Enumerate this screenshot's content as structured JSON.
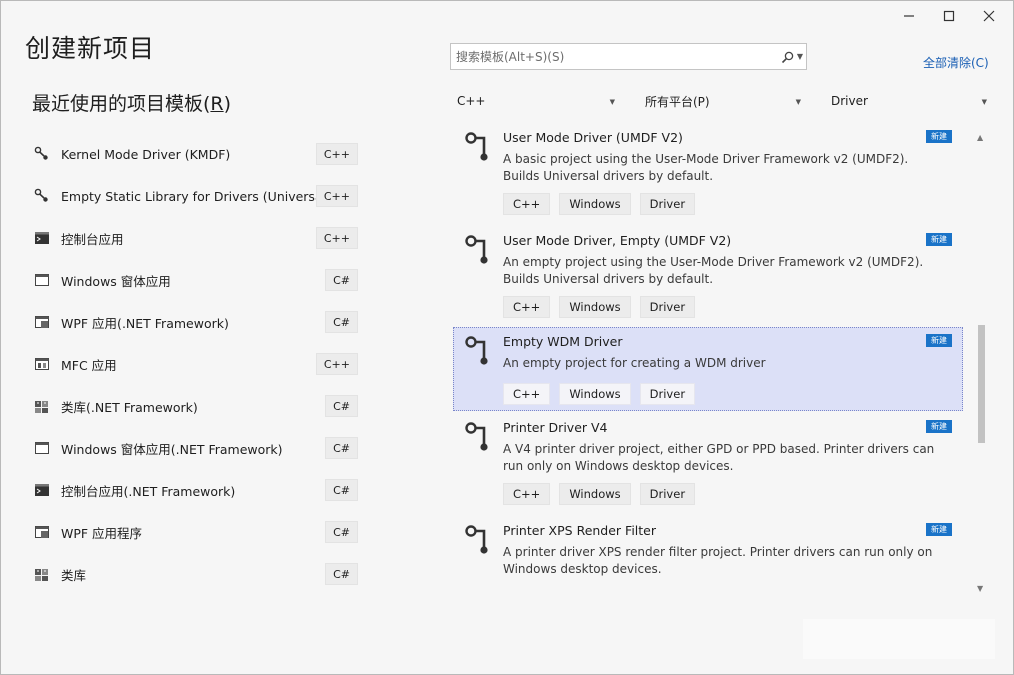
{
  "window": {
    "title": "创建新项目",
    "caption": {
      "minimize": "—",
      "maximize": "☐",
      "close": "✕"
    }
  },
  "recent": {
    "title_pre": "最近使用的项目模板(",
    "title_key": "R",
    "title_post": ")",
    "items": [
      {
        "name": "Kernel Mode Driver (KMDF)",
        "lang": "C++",
        "icon": "driver-icon"
      },
      {
        "name": "Empty Static Library for Drivers (Universal)",
        "lang": "C++",
        "icon": "driver-icon"
      },
      {
        "name": "控制台应用",
        "lang": "C++",
        "icon": "console-icon"
      },
      {
        "name": "Windows 窗体应用",
        "lang": "C#",
        "icon": "window-form-icon"
      },
      {
        "name": "WPF 应用(.NET Framework)",
        "lang": "C#",
        "icon": "wpf-icon"
      },
      {
        "name": "MFC 应用",
        "lang": "C++",
        "icon": "mfc-icon"
      },
      {
        "name": "类库(.NET Framework)",
        "lang": "C#",
        "icon": "class-library-icon"
      },
      {
        "name": "Windows 窗体应用(.NET Framework)",
        "lang": "C#",
        "icon": "window-form-icon"
      },
      {
        "name": "控制台应用(.NET Framework)",
        "lang": "C#",
        "icon": "console-icon"
      },
      {
        "name": "WPF 应用程序",
        "lang": "C#",
        "icon": "wpf-icon"
      },
      {
        "name": "类库",
        "lang": "C#",
        "icon": "class-library-icon"
      }
    ]
  },
  "search": {
    "placeholder": "搜索模板(Alt+S)(S)"
  },
  "clear_all": "全部清除(C)",
  "filters": {
    "language": "C++",
    "platform": "所有平台(P)",
    "project_type": "Driver"
  },
  "templates": [
    {
      "name": "User Mode Driver (UMDF V2)",
      "desc": "A basic project using the User-Mode Driver Framework v2 (UMDF2). Builds Universal drivers by default.",
      "tags": [
        "C++",
        "Windows",
        "Driver"
      ],
      "badge": "新建",
      "selected": false
    },
    {
      "name": "User Mode Driver, Empty (UMDF V2)",
      "desc": "An empty project using the User-Mode Driver Framework v2 (UMDF2). Builds Universal drivers by default.",
      "tags": [
        "C++",
        "Windows",
        "Driver"
      ],
      "badge": "新建",
      "selected": false
    },
    {
      "name": "Empty WDM Driver",
      "desc": "An empty project for creating a WDM driver",
      "tags": [
        "C++",
        "Windows",
        "Driver"
      ],
      "badge": "新建",
      "selected": true
    },
    {
      "name": "Printer Driver V4",
      "desc": "A V4 printer driver project, either GPD or PPD based. Printer drivers can run only on Windows desktop devices.",
      "tags": [
        "C++",
        "Windows",
        "Driver"
      ],
      "badge": "新建",
      "selected": false
    },
    {
      "name": "Printer XPS Render Filter",
      "desc": "A printer driver XPS render filter project. Printer drivers can run only on Windows desktop devices.",
      "tags": [],
      "badge": "新建",
      "selected": false
    }
  ],
  "colors": {
    "accent": "#1a73c8",
    "selected_bg": "#dce0f7",
    "link": "#1a5fb4"
  }
}
